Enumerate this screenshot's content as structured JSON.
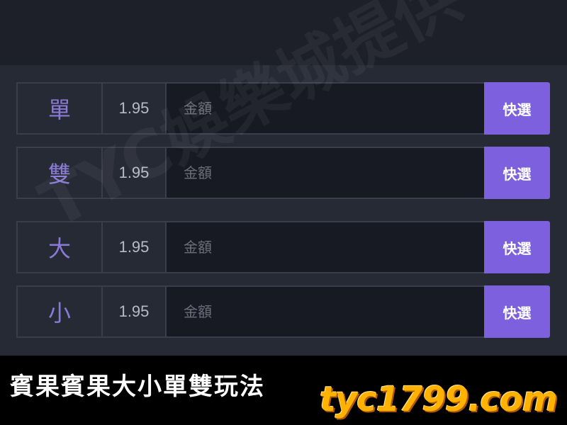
{
  "bets": [
    {
      "name": "單",
      "odds": "1.95",
      "amount_placeholder": "金額",
      "quick_label": "快選"
    },
    {
      "name": "雙",
      "odds": "1.95",
      "amount_placeholder": "金額",
      "quick_label": "快選"
    },
    {
      "name": "大",
      "odds": "1.95",
      "amount_placeholder": "金額",
      "quick_label": "快選"
    },
    {
      "name": "小",
      "odds": "1.95",
      "amount_placeholder": "金額",
      "quick_label": "快選"
    }
  ],
  "caption": "賓果賓果大小單雙玩法",
  "site_logo": "tyc1799.com",
  "watermark": "TYC娛樂城提供",
  "colors": {
    "accent": "#7c60dd",
    "bet_name": "#8a7ad6",
    "logo": "#ffb300",
    "background": "#262a35",
    "input_bg": "#171a23"
  }
}
